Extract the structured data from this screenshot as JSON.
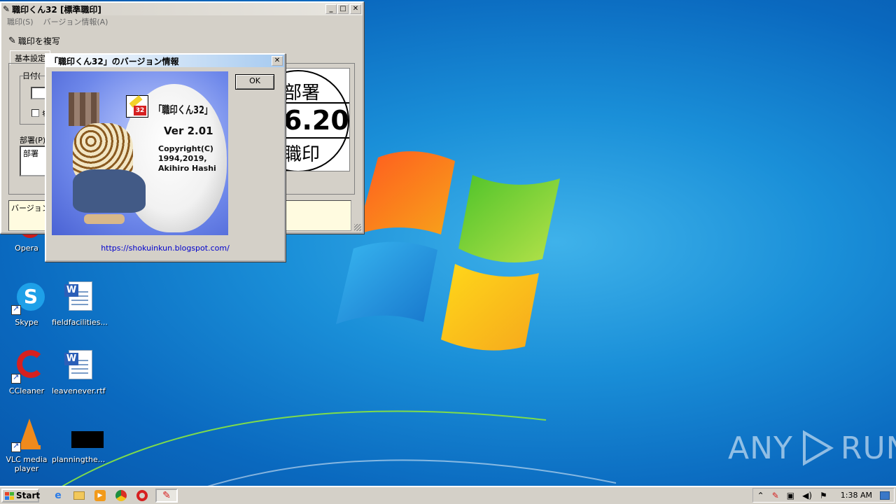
{
  "desktop": {
    "icons": [
      {
        "label": "Opera"
      },
      {
        "label": "Skype"
      },
      {
        "label": "fieldfacilities..."
      },
      {
        "label": "CCleaner"
      },
      {
        "label": "leavenever.rtf"
      },
      {
        "label": "VLC media player"
      },
      {
        "label": "planningthe..."
      }
    ],
    "watermark": "ANY RUN"
  },
  "main_window": {
    "title": "職印くん32 [標準職印]",
    "menu": [
      "職印(S)",
      "バージョン情報(A)"
    ],
    "copy_button": "職印を複写",
    "tab_basic": "基本設定",
    "group_date_label": "日付(",
    "checkbox_partial": "ｷ",
    "dept_label": "部署(P)",
    "dept_value": "部署",
    "stamp_top": "部署",
    "stamp_date": "6.20",
    "stamp_bottom": "職印",
    "status_text": "バージョン"
  },
  "about_dialog": {
    "title": "「職印くん32」のバージョン情報",
    "ok_label": "OK",
    "app_name": "「職印くん32」",
    "version": "Ver 2.01",
    "copyright_line1": "Copyright(C)",
    "copyright_line2": "1994,2019,",
    "copyright_line3": "Akihiro Hashi",
    "url": "https://shokuinkun.blogspot.com/",
    "icon_badge": "32"
  },
  "taskbar": {
    "start_label": "Start",
    "clock": "1:38 AM"
  },
  "colors": {
    "desktop": "#1a8fd8",
    "window_face": "#d4d0c8",
    "link": "#0000cc",
    "status_bg": "#fffbe0"
  }
}
